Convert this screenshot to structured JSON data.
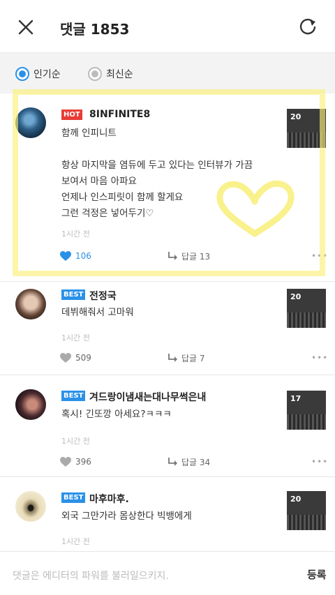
{
  "header": {
    "title": "댓글 1853"
  },
  "sort": {
    "popular_label": "인기순",
    "latest_label": "최신순",
    "selected": "popular"
  },
  "comments": [
    {
      "badge": "HOT",
      "author": "8INFINITE8",
      "body": "함께 인피니트\n\n항상 마지막을 염듀에 두고 있다는 인터뷰가 가끔\n보여서 마음 아파요\n언제나 인스피릿이 함께 할게요\n그런 걱정은 넣어두기♡",
      "time": "1시간 전",
      "likes": "106",
      "liked": true,
      "reply_label": "답글 13",
      "thumb_num": "20"
    },
    {
      "badge": "BEST",
      "author": "전정국",
      "body": "데뷔해줘서 고마워",
      "time": "1시간 전",
      "likes": "509",
      "liked": false,
      "reply_label": "답글 7",
      "thumb_num": "20"
    },
    {
      "badge": "BEST",
      "author": "겨드랑이냄새는대나무썩은내",
      "body": "혹시! 긴또깡 아세요?ㅋㅋㅋ",
      "time": "1시간 전",
      "likes": "396",
      "liked": false,
      "reply_label": "답글 34",
      "thumb_num": "17"
    },
    {
      "badge": "BEST",
      "author": "마후마후.",
      "body": "외국 그만가라 몸상한다 빅뱅에게",
      "time": "1시간 전",
      "likes": "",
      "liked": false,
      "reply_label": "",
      "thumb_num": "20"
    }
  ],
  "input": {
    "placeholder": "댓글은 에디터의 파워를 불러일으키지.",
    "submit_label": "등록"
  },
  "colors": {
    "accent": "#2a91e8",
    "hot": "#e83b36",
    "highlight": "#f8ee78"
  },
  "icons": {
    "close": "close-icon",
    "refresh": "refresh-icon",
    "like": "heart-icon",
    "reply": "reply-arrow-icon",
    "more": "more-icon"
  }
}
